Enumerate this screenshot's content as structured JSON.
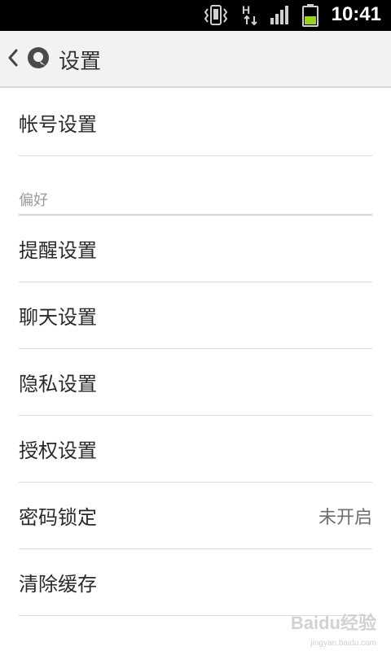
{
  "status_bar": {
    "time": "10:41",
    "network_label": "H",
    "icons": [
      "vibrate-icon",
      "network-h-icon",
      "signal-icon",
      "battery-icon"
    ]
  },
  "title_bar": {
    "title": "设置",
    "back_icon": "chevron-left-icon",
    "logo_icon": "app-logo-icon"
  },
  "settings": {
    "account": {
      "label": "帐号设置"
    },
    "section_preferences": "偏好",
    "items": [
      {
        "label": "提醒设置",
        "value": ""
      },
      {
        "label": "聊天设置",
        "value": ""
      },
      {
        "label": "隐私设置",
        "value": ""
      },
      {
        "label": "授权设置",
        "value": ""
      },
      {
        "label": "密码锁定",
        "value": "未开启"
      },
      {
        "label": "清除缓存",
        "value": ""
      }
    ]
  },
  "watermark": {
    "brand": "Baidu经验",
    "url": "jingyan.baidu.com"
  },
  "colors": {
    "status_bar_bg": "#000000",
    "title_bar_bg": "#f2f2f2",
    "battery_green": "#9bd21c",
    "divider": "#dcdcdc"
  }
}
